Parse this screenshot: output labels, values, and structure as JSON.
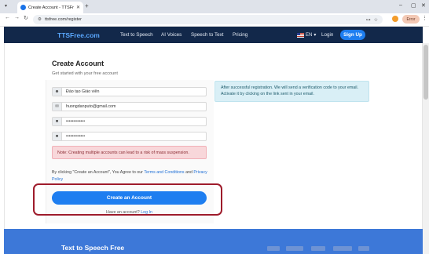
{
  "browser": {
    "tab_title": "Create Account - TTSFree.com",
    "url": "ttsfree.com/register",
    "profile_label": "Error"
  },
  "site_nav": {
    "logo": "TTSFree.com",
    "links": [
      "Text to Speech",
      "AI Voices",
      "Speech to Text",
      "Pricing"
    ],
    "language": "EN",
    "login": "Login",
    "signup": "Sign Up"
  },
  "form": {
    "title": "Create Account",
    "subtitle": "Get started with your free account",
    "fields": [
      {
        "icon": "user-icon",
        "value": "Đào tạo Giáo viên",
        "type": "text"
      },
      {
        "icon": "email-icon",
        "value": "huongdanputo@gmail.com",
        "type": "text"
      },
      {
        "icon": "lock-icon",
        "value": "•••••••••••••",
        "type": "password"
      },
      {
        "icon": "lock-icon",
        "value": "•••••••••••••",
        "type": "password"
      }
    ],
    "note": "Note: Creating multiple accounts can lead to a risk of mass suspension.",
    "terms_prefix": "By clicking \"Create an Account\", You Agree to our",
    "terms_link": "Terms and Conditions",
    "terms_and": "and",
    "privacy_link": "Privacy Policy",
    "create_button": "Create an Account",
    "have_account": "Have an account?",
    "login_link": "Log In"
  },
  "info_box": "After successful registration. We will send a verification code to your email. Activate it by clicking on the link sent in your email.",
  "footer": {
    "title": "Text to Speech Free"
  },
  "colors": {
    "nav_bg": "#12284a",
    "primary": "#1e7ef0",
    "highlight": "#9e1b2b",
    "footer_bg": "#3d78d8"
  }
}
